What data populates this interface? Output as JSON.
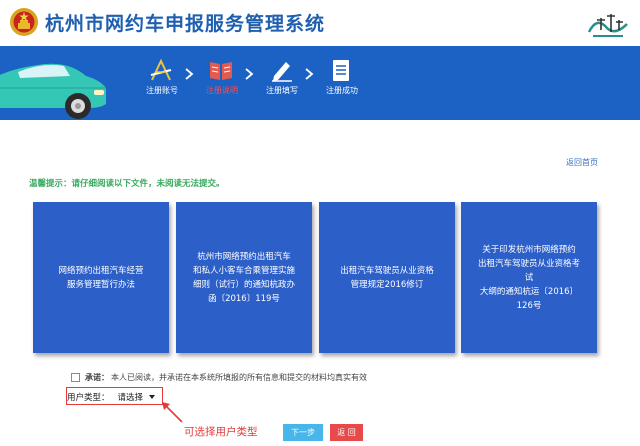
{
  "header": {
    "title": "杭州市网约车申报服务管理系统",
    "emblem_icon": "national-emblem-icon",
    "city_logo_icon": "hangzhou-city-logo-icon"
  },
  "steps": [
    {
      "label": "注册账号",
      "icon": "pen-ruler-icon",
      "active": false
    },
    {
      "label": "注册说明",
      "icon": "open-book-icon",
      "active": true
    },
    {
      "label": "注册填写",
      "icon": "pencil-icon",
      "active": false
    },
    {
      "label": "注册成功",
      "icon": "checklist-icon",
      "active": false
    }
  ],
  "back_home": "返回首页",
  "notice": "温馨提示：请仔细阅读以下文件，未阅读无法提交。",
  "documents": [
    {
      "lines": [
        "网络预约出租汽车经营",
        "服务管理暂行办法"
      ]
    },
    {
      "lines": [
        "杭州市网络预约出租汽车",
        "和私人小客车合乘管理实施",
        "细则（试行）的通知杭政办",
        "函〔2016〕119号"
      ]
    },
    {
      "lines": [
        "出租汽车驾驶员从业资格",
        "管理规定2016修订"
      ]
    },
    {
      "lines": [
        "关于印发杭州市网络预约",
        "出租汽车驾驶员从业资格考试",
        "大纲的通知杭运〔2016〕",
        "126号"
      ]
    }
  ],
  "agreement": {
    "bold_label": "承诺：",
    "text": "本人已阅读，并承诺在本系统所填报的所有信息和提交的材料均真实有效"
  },
  "user_type": {
    "label": "用户类型：",
    "selected": "请选择"
  },
  "annotation": "可选择用户类型",
  "buttons": {
    "next": "下一步",
    "back": "返 回"
  },
  "colors": {
    "title_blue": "#1f5fb0",
    "banner_blue": "#1c62c4",
    "card_blue": "#2d5fc9",
    "notice_green": "#39a85f",
    "active_red": "#ff4a4a",
    "next_button": "#48b6e8",
    "back_button": "#e64a4a"
  }
}
